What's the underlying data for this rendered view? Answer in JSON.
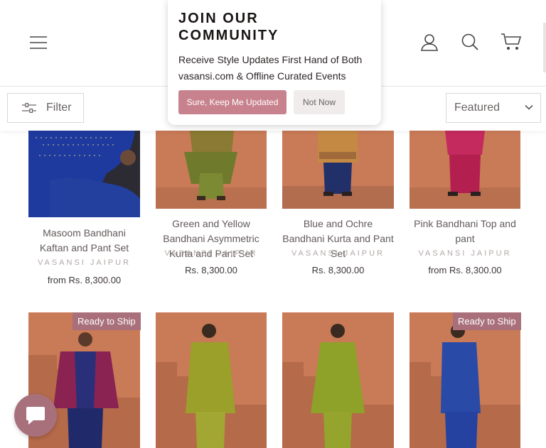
{
  "header": {
    "icons": [
      "hamburger-icon",
      "account-icon",
      "search-icon",
      "cart-icon"
    ]
  },
  "toolbar": {
    "filter_label": "Filter",
    "sort_value": "Featured"
  },
  "popup": {
    "title": "JOIN OUR COMMUNITY",
    "body": "Receive Style Updates First Hand of Both vasansi.com & Offline Curated Events",
    "accept_label": "Sure, Keep Me Updated",
    "decline_label": "Not Now"
  },
  "products_row1": [
    {
      "title": "Masoom Bandhani Kaftan and Pant Set",
      "vendor": "VASANSI JAIPUR",
      "price": "from Rs. 8,300.00"
    },
    {
      "title": "Green and Yellow Bandhani Asymmetric Kurta and Pant Set",
      "vendor": "VASANSI JAIPUR",
      "price": "Rs. 8,300.00"
    },
    {
      "title": "Blue and Ochre Bandhani Kurta and Pant Set",
      "vendor": "VASANSI JAIPUR",
      "price": "Rs. 8,300.00"
    },
    {
      "title": "Pink Bandhani Top and pant",
      "vendor": "VASANSI JAIPUR",
      "price": "from Rs. 8,300.00"
    }
  ],
  "products_row2": [
    {
      "badge": "Ready to Ship"
    },
    {
      "badge": ""
    },
    {
      "badge": ""
    },
    {
      "badge": "Ready to Ship"
    }
  ],
  "colors": {
    "accent": "#c8828e",
    "badge": "#a9707b",
    "backdrop": "#c97a57"
  }
}
